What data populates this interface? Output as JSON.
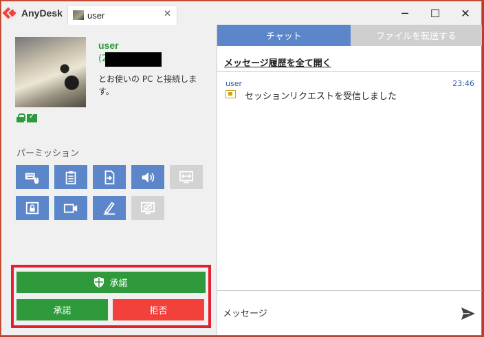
{
  "app": {
    "name": "AnyDesk"
  },
  "tab": {
    "label": "user",
    "close": "✕"
  },
  "window_controls": {
    "minimize": "─",
    "maximize": "☐",
    "close": "✕"
  },
  "session": {
    "user_name": "user",
    "user_id_prefix": "(2",
    "description": "とお使いの PC と接続します。"
  },
  "permissions": {
    "title": "パーミッション",
    "items": [
      {
        "icon": "keyboard-mouse-icon",
        "enabled": true
      },
      {
        "icon": "clipboard-icon",
        "enabled": true
      },
      {
        "icon": "file-transfer-icon",
        "enabled": true
      },
      {
        "icon": "speaker-icon",
        "enabled": true
      },
      {
        "icon": "switch-sides-icon",
        "enabled": false
      },
      {
        "icon": "lock-screen-icon",
        "enabled": true
      },
      {
        "icon": "record-icon",
        "enabled": true
      },
      {
        "icon": "draw-icon",
        "enabled": true
      },
      {
        "icon": "privacy-mode-icon",
        "enabled": false
      }
    ]
  },
  "actions": {
    "accept_full": "承諾",
    "accept": "承諾",
    "reject": "拒否"
  },
  "chat": {
    "tab_chat": "チャット",
    "tab_file": "ファイルを転送する",
    "history_link": "メッセージ履歴を全て開く",
    "messages": [
      {
        "user": "user",
        "time": "23:46",
        "text": "セッションリクエストを受信しました"
      }
    ],
    "input_placeholder": "メッセージ"
  },
  "colors": {
    "accent_blue": "#5b86c9",
    "accept_green": "#2e9a3c",
    "reject_red": "#f2403a",
    "highlight_red": "#e2202f"
  }
}
